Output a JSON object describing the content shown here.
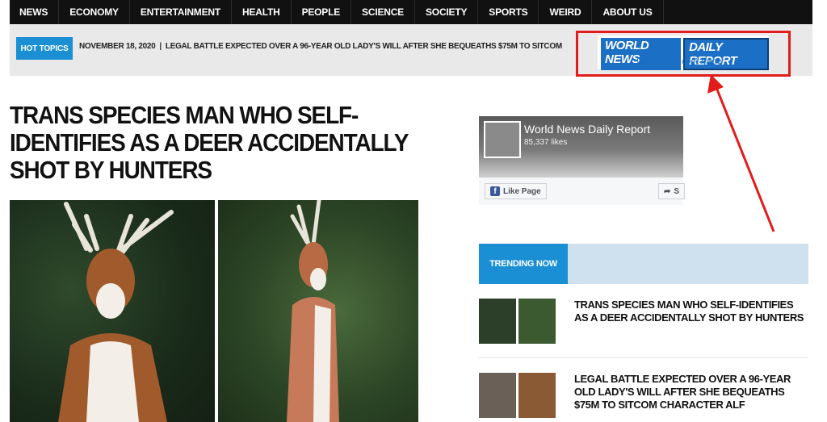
{
  "nav": {
    "items": [
      "NEWS",
      "ECONOMY",
      "ENTERTAINMENT",
      "HEALTH",
      "PEOPLE",
      "SCIENCE",
      "SOCIETY",
      "SPORTS",
      "WEIRD",
      "ABOUT US"
    ]
  },
  "hot_topics": {
    "badge": "HOT TOPICS",
    "date": "NOVEMBER 18, 2020",
    "separator": "|",
    "headline": "LEGAL BATTLE EXPECTED OVER A 96-YEAR OLD LADY'S WILL AFTER SHE BEQUEATHS $75M TO SITCOM"
  },
  "logo": {
    "part1": "WORLD NEWS",
    "part2": "DAILY REPORT",
    "tagline": "Where facts don't matter"
  },
  "article": {
    "headline": "TRANS SPECIES MAN WHO SELF-IDENTIFIES AS A DEER ACCIDENTALLY SHOT BY HUNTERS"
  },
  "facebook": {
    "page_name": "World News Daily Report",
    "likes": "85,337 likes",
    "like_button": "Like Page",
    "share_button": "S"
  },
  "trending": {
    "header": "TRENDING NOW",
    "items": [
      "TRANS SPECIES MAN WHO SELF-IDENTIFIES AS A DEER ACCIDENTALLY SHOT BY HUNTERS",
      "LEGAL BATTLE EXPECTED OVER A 96-YEAR OLD LADY'S WILL AFTER SHE BEQUEATHS $75M TO SITCOM CHARACTER ALF"
    ]
  },
  "colors": {
    "accent_blue": "#1b8fd3",
    "annotation_red": "#e21b1b",
    "nav_bg": "#111111"
  }
}
